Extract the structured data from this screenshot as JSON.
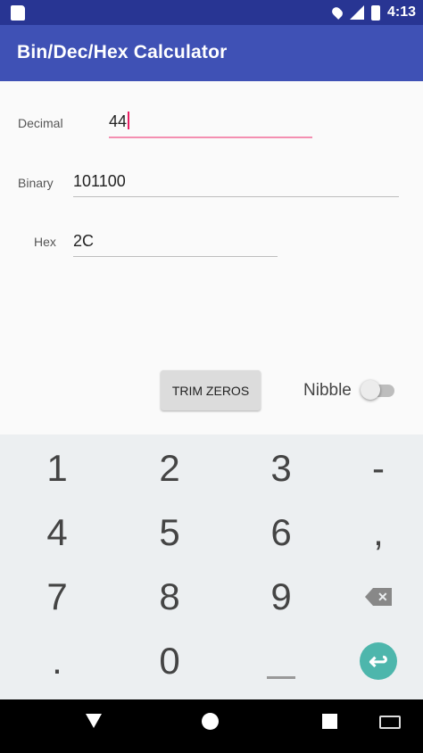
{
  "status_bar": {
    "time": "4:13",
    "icons": [
      "sd-card-icon",
      "location-icon",
      "signal-icon",
      "battery-icon"
    ]
  },
  "app_bar": {
    "title": "Bin/Dec/Hex Calculator",
    "color": "#3f51b5"
  },
  "form": {
    "decimal": {
      "label": "Decimal",
      "value": "44"
    },
    "binary": {
      "label": "Binary",
      "value": "101100"
    },
    "hex": {
      "label": "Hex",
      "value": "2C"
    }
  },
  "actions": {
    "trim_zeros_label": "TRIM ZEROS",
    "nibble_label": "Nibble"
  },
  "keyboard": {
    "row1": [
      "1",
      "2",
      "3",
      "-"
    ],
    "row2": [
      "4",
      "5",
      "6",
      ","
    ],
    "row3": [
      "7",
      "8",
      "9"
    ],
    "row4": [
      ".",
      "0"
    ],
    "enter_glyph": "↩",
    "accent": "#4db6ac"
  },
  "nav_bar": {
    "icons": [
      "back-icon",
      "home-icon",
      "recents-icon",
      "keyboard-icon"
    ]
  }
}
